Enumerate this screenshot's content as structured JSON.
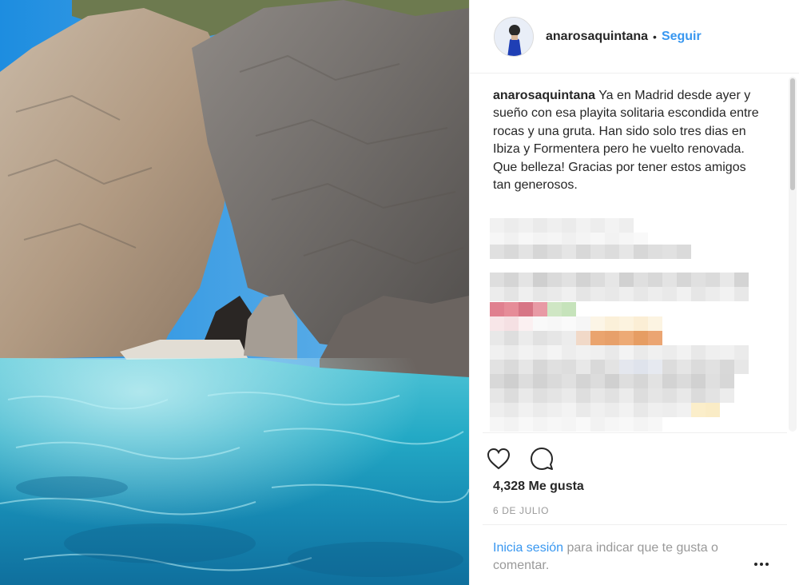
{
  "header": {
    "username": "anarosaquintana",
    "separator": "•",
    "follow_label": "Seguir"
  },
  "caption": {
    "username": "anarosaquintana",
    "text": " Ya en Madrid desde ayer y sueño con esa playita solitaria escondida entre rocas y una gruta. Han sido solo tres dias en Ibiza y Formentera pero he vuelto renovada. Que belleza! Gracias por tener estos amigos tan generosos."
  },
  "actions": {
    "like_icon": "heart-icon",
    "comment_icon": "comment-icon"
  },
  "likes_text": "4,328 Me gusta",
  "date_text": "6 DE JULIO",
  "login": {
    "link_text": "Inicia sesión",
    "rest_text": " para indicar que te gusta o comentar."
  },
  "more_icon": "more-options-icon",
  "colors": {
    "link_blue": "#3897f0",
    "text_dark": "#262626",
    "text_muted": "#999999",
    "divider": "#efefef"
  }
}
